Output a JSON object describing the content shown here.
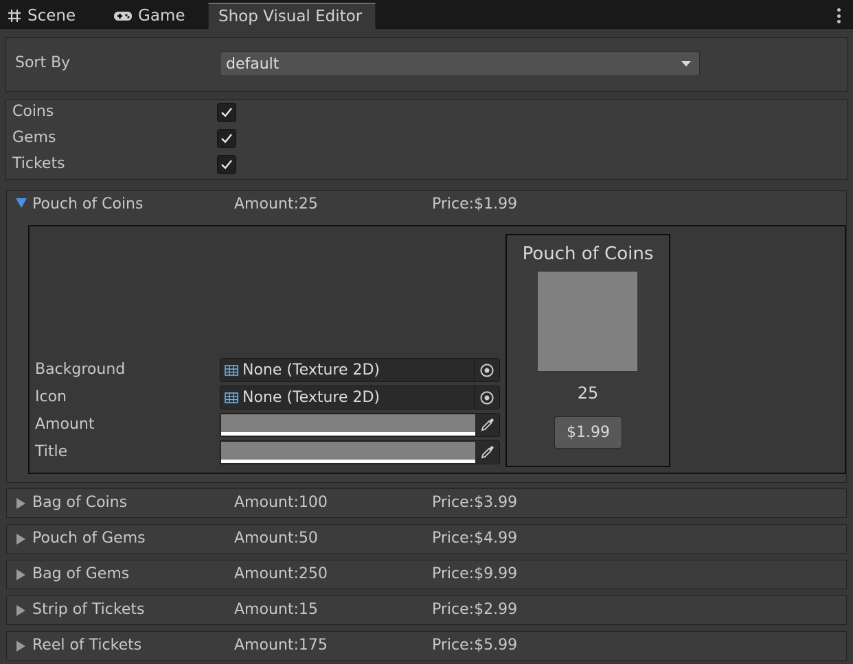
{
  "tabs": {
    "scene": "Scene",
    "game": "Game",
    "shop": "Shop Visual Editor"
  },
  "sort": {
    "label": "Sort By",
    "value": "default"
  },
  "filters": [
    {
      "label": "Coins",
      "checked": true
    },
    {
      "label": "Gems",
      "checked": true
    },
    {
      "label": "Tickets",
      "checked": true
    }
  ],
  "items": [
    {
      "title": "Pouch of Coins",
      "amount": "Amount:25",
      "price": "Price:$1.99",
      "expanded": true
    },
    {
      "title": "Bag of Coins",
      "amount": "Amount:100",
      "price": "Price:$3.99",
      "expanded": false
    },
    {
      "title": "Pouch of Gems",
      "amount": "Amount:50",
      "price": "Price:$4.99",
      "expanded": false
    },
    {
      "title": "Bag of Gems",
      "amount": "Amount:250",
      "price": "Price:$9.99",
      "expanded": false
    },
    {
      "title": "Strip of Tickets",
      "amount": "Amount:15",
      "price": "Price:$2.99",
      "expanded": false
    },
    {
      "title": "Reel of Tickets",
      "amount": "Amount:175",
      "price": "Price:$5.99",
      "expanded": false
    }
  ],
  "detail": {
    "background_label": "Background",
    "background_value": "None (Texture 2D)",
    "icon_label": "Icon",
    "icon_value": "None (Texture 2D)",
    "amount_label": "Amount",
    "title_label": "Title"
  },
  "preview": {
    "title": "Pouch of Coins",
    "amount": "25",
    "price_button": "$1.99"
  },
  "colors": {
    "accent": "#3a79bb",
    "foldout_expanded": "#4a8fe0",
    "swatch": "#808080"
  }
}
